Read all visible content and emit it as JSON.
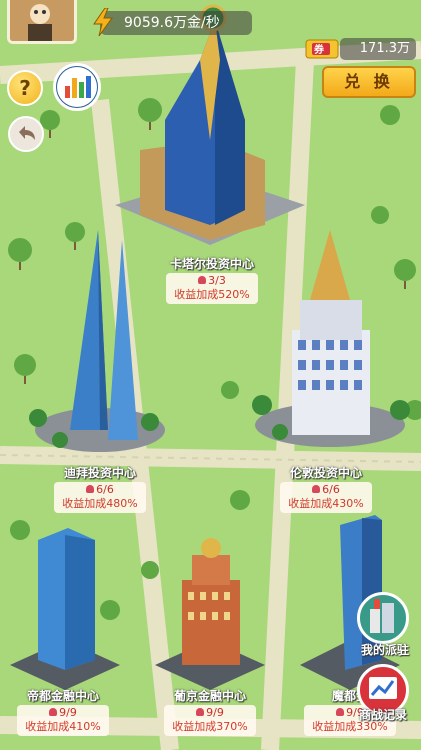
{
  "header": {
    "income_rate": "9059.6万金/秒",
    "coupon_balance": "171.3万",
    "coupon_icon_text": "券",
    "exchange_label": "兑 换",
    "help_symbol": "?"
  },
  "buildings": [
    {
      "name": "卡塔尔投资中心",
      "count": "3/3",
      "bonus": "收益加成520%"
    },
    {
      "name": "迪拜投资中心",
      "count": "6/6",
      "bonus": "收益加成480%"
    },
    {
      "name": "伦敦投资中心",
      "count": "6/6",
      "bonus": "收益加成430%"
    },
    {
      "name": "帝都金融中心",
      "count": "9/9",
      "bonus": "收益加成410%"
    },
    {
      "name": "葡京金融中心",
      "count": "9/9",
      "bonus": "收益加成370%"
    },
    {
      "name": "魔都金",
      "count": "9/9",
      "bonus": "收益加成330%"
    }
  ],
  "side_buttons": {
    "my_station": "我的派驻",
    "battle_record": "商战记录"
  },
  "colors": {
    "grass": "#a9d87a",
    "road": "#e7e4c6",
    "accent_gold": "#f3a91a",
    "bonus_red": "#d23a2a"
  }
}
